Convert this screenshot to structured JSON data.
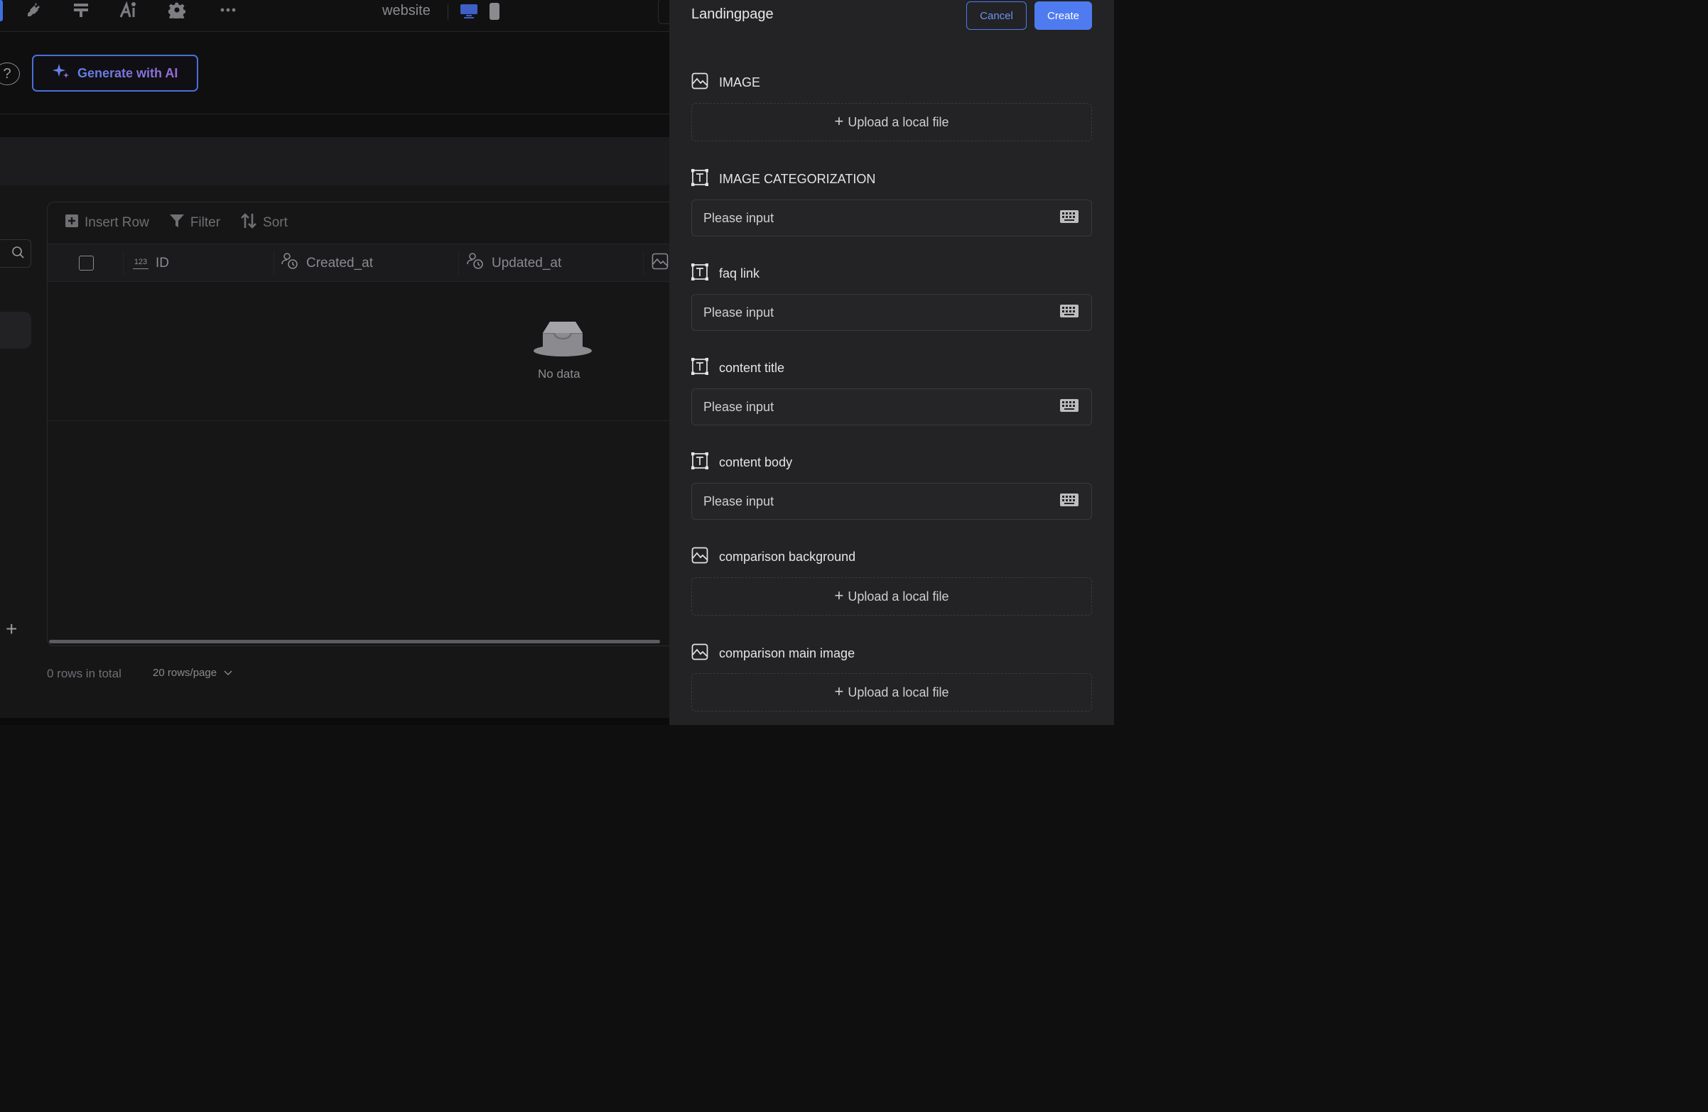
{
  "topbar": {
    "project_name": "website",
    "icons": [
      "plug-icon",
      "layers-icon",
      "ai-icon",
      "gear-icon",
      "more-icon"
    ],
    "devices": [
      "desktop-icon",
      "mobile-icon"
    ]
  },
  "ai": {
    "generate_label": "Generate with AI",
    "help_symbol": "?"
  },
  "table": {
    "toolbar": {
      "insert_row": "Insert Row",
      "filter": "Filter",
      "sort": "Sort"
    },
    "columns": [
      {
        "label": "ID",
        "type_badge": "123"
      },
      {
        "label": "Created_at"
      },
      {
        "label": "Updated_at"
      }
    ],
    "empty_text": "No data"
  },
  "footer": {
    "total": "0 rows in total",
    "page_size": "20 rows/page"
  },
  "drawer": {
    "title": "Landingpage",
    "cancel_label": "Cancel",
    "create_label": "Create",
    "upload_label": "Upload a local file",
    "input_placeholder": "Please input",
    "fields": [
      {
        "label": "IMAGE",
        "kind": "image"
      },
      {
        "label": "IMAGE CATEGORIZATION",
        "kind": "text"
      },
      {
        "label": "faq link",
        "kind": "text"
      },
      {
        "label": "content title",
        "kind": "text"
      },
      {
        "label": "content body",
        "kind": "text"
      },
      {
        "label": "comparison background",
        "kind": "image"
      },
      {
        "label": "comparison main image",
        "kind": "image"
      }
    ]
  },
  "colors": {
    "accent": "#4f7bf0",
    "drawer_bg": "#232325",
    "app_bg": "#0f0f10"
  }
}
